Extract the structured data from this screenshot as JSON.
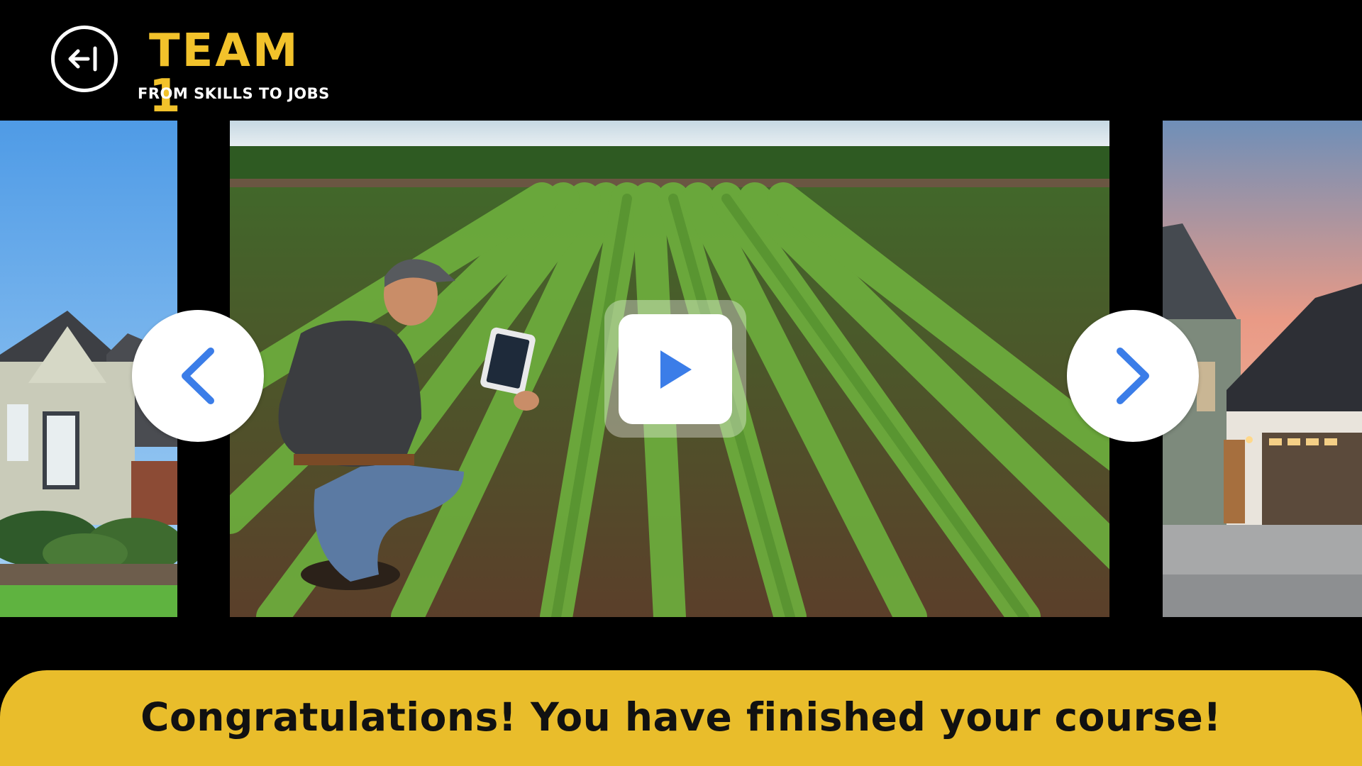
{
  "header": {
    "back_icon": "back-arrow-circle-icon",
    "title": "TEAM 1",
    "subtitle": "FROM SKILLS TO JOBS"
  },
  "carousel": {
    "slides": [
      {
        "position": "previous",
        "subject": "suburban house with lawn"
      },
      {
        "position": "current",
        "subject": "farmer kneeling in soybean field with tablet"
      },
      {
        "position": "next",
        "subject": "modern house with garage at sunset"
      }
    ],
    "prev_icon": "chevron-left-icon",
    "next_icon": "chevron-right-icon",
    "play_icon": "play-icon"
  },
  "banner": {
    "message": "Congratulations! You have finished your course!"
  },
  "colors": {
    "brand_yellow": "#f2c22b",
    "banner_yellow": "#e9bd2b",
    "accent_blue": "#3b7de8",
    "background": "#000000"
  }
}
